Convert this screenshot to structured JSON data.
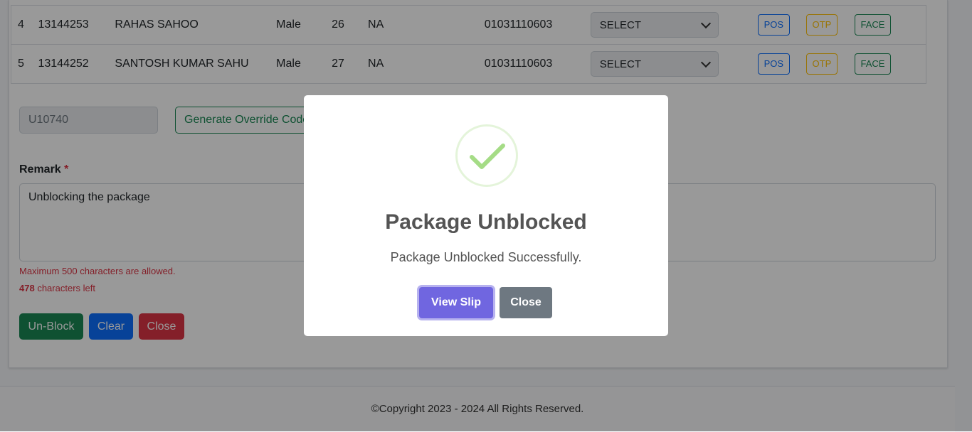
{
  "table": {
    "rows": [
      {
        "sno": "4",
        "id": "13144253",
        "name": "RAHAS SAHOO",
        "gender": "Male",
        "age": "26",
        "col6": "NA",
        "phone": "01031110603",
        "select": "SELECT",
        "pos": "POS",
        "otp": "OTP",
        "face": "FACE"
      },
      {
        "sno": "5",
        "id": "13144252",
        "name": "SANTOSH KUMAR SAHU",
        "gender": "Male",
        "age": "27",
        "col6": "NA",
        "phone": "01031110603",
        "select": "SELECT",
        "pos": "POS",
        "otp": "OTP",
        "face": "FACE"
      }
    ]
  },
  "override": {
    "code": "U10740",
    "generate_label": "Generate Override Code"
  },
  "remark": {
    "label": "Remark",
    "required_mark": "*",
    "value": "Unblocking the package",
    "max_warning": "Maximum 500 characters are allowed.",
    "chars_left_count": "478",
    "chars_left_label": "characters left"
  },
  "actions": {
    "unblock": "Un-Block",
    "clear": "Clear",
    "close": "Close"
  },
  "footer": {
    "text": "©Copyright 2023 - 2024 All Rights Reserved."
  },
  "modal": {
    "title": "Package Unblocked",
    "message": "Package Unblocked Successfully.",
    "view_slip": "View Slip",
    "close": "Close",
    "icon": "success-check-icon"
  },
  "colors": {
    "success": "#198754",
    "primary": "#0d6efd",
    "danger": "#dc3545",
    "warning": "#ffc107",
    "modal_confirm": "#7066e0",
    "modal_cancel": "#6e7881",
    "check": "#a5dc86"
  }
}
